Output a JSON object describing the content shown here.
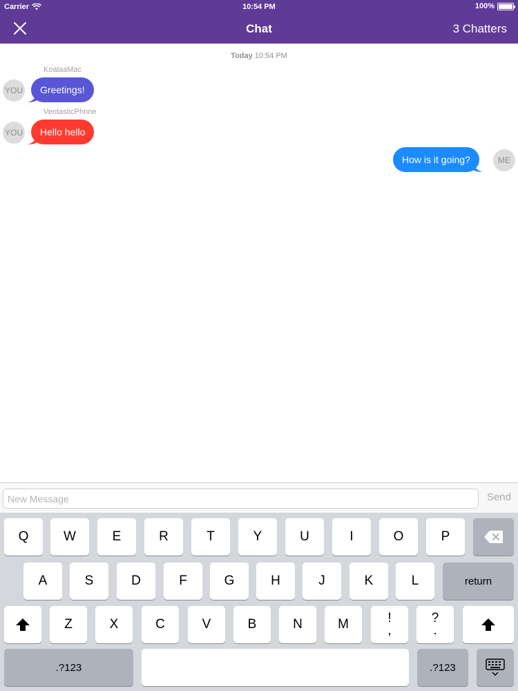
{
  "status_bar": {
    "carrier": "Carrier",
    "time": "10:54 PM",
    "battery": "100%"
  },
  "nav": {
    "title": "Chat",
    "right": "3 Chatters",
    "close_icon": "close-icon"
  },
  "chat": {
    "timestamp_day": "Today",
    "timestamp_time": "10:54 PM",
    "messages": [
      {
        "sender": "KoalaaMac",
        "avatar": "YOU",
        "text": "Greetings!",
        "color": "#5856d6"
      },
      {
        "sender": "VentasticPhone",
        "avatar": "YOU",
        "text": "Hello hello",
        "color": "#ff3b30"
      },
      {
        "avatar": "ME",
        "text": "How is it going?",
        "color": "#1a8cff"
      }
    ]
  },
  "input": {
    "placeholder": "New Message",
    "send_label": "Send"
  },
  "keyboard": {
    "row1": [
      "Q",
      "W",
      "E",
      "R",
      "T",
      "Y",
      "U",
      "I",
      "O",
      "P"
    ],
    "row2": [
      "A",
      "S",
      "D",
      "F",
      "G",
      "H",
      "J",
      "K",
      "L"
    ],
    "row3": [
      "Z",
      "X",
      "C",
      "V",
      "B",
      "N",
      "M"
    ],
    "return_label": "return",
    "numbers_label": ".?123",
    "punct1_top": "!",
    "punct1_bottom": ",",
    "punct2_top": "?",
    "punct2_bottom": ".",
    "icons": [
      "backspace-icon",
      "shift-icon",
      "keyboard-dismiss-icon"
    ]
  },
  "colors": {
    "header": "#5e3b96",
    "keyboard_bg": "#d4d7dc"
  }
}
